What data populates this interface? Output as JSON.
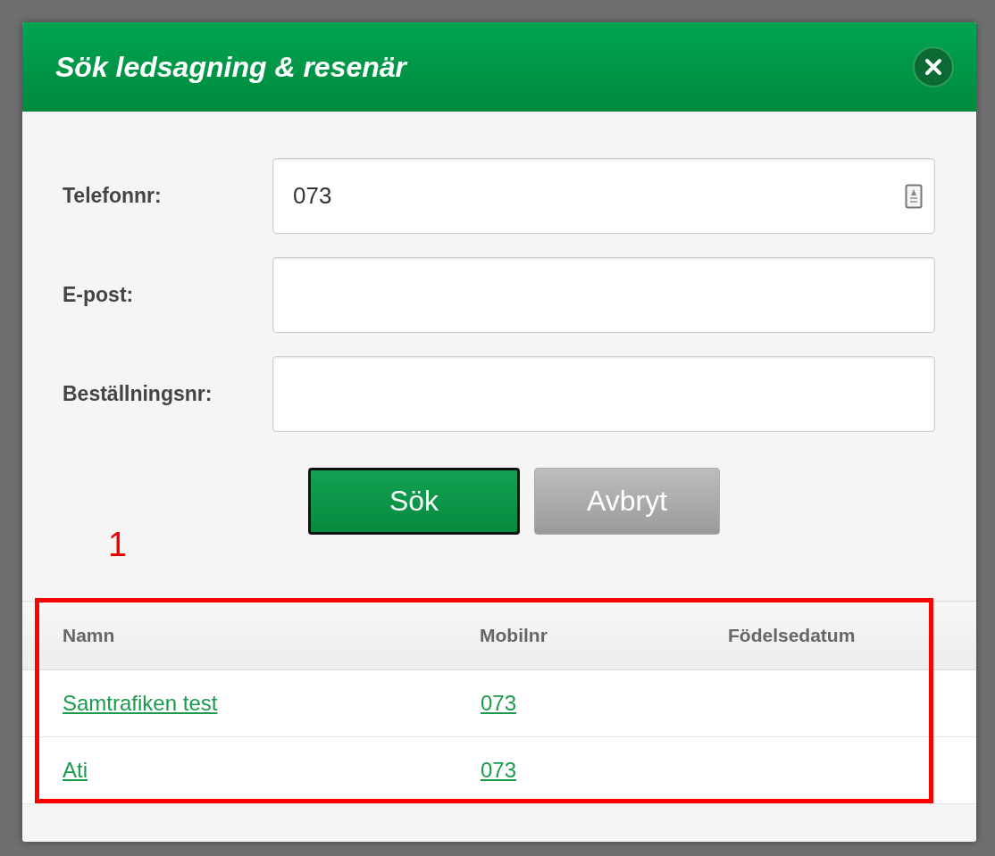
{
  "dialog": {
    "title": "Sök ledsagning & resenär"
  },
  "fields": [
    {
      "label": "Telefonnr:",
      "value": "073",
      "kind": "contact"
    },
    {
      "label": "E-post:",
      "kind": "plain"
    },
    {
      "label": "Beställningsnr:",
      "kind": "plain"
    }
  ],
  "buttons": [
    {
      "label": "Sök",
      "kind": "primary"
    },
    {
      "label": "Avbryt",
      "kind": "secondary"
    }
  ],
  "annotation": {
    "label": "1"
  },
  "table": {
    "columns": [
      "Namn",
      "Mobilnr",
      "Födelsedatum"
    ],
    "rows": [
      [
        "Samtrafiken test",
        "073"
      ],
      [
        "Ati",
        "073"
      ]
    ]
  }
}
